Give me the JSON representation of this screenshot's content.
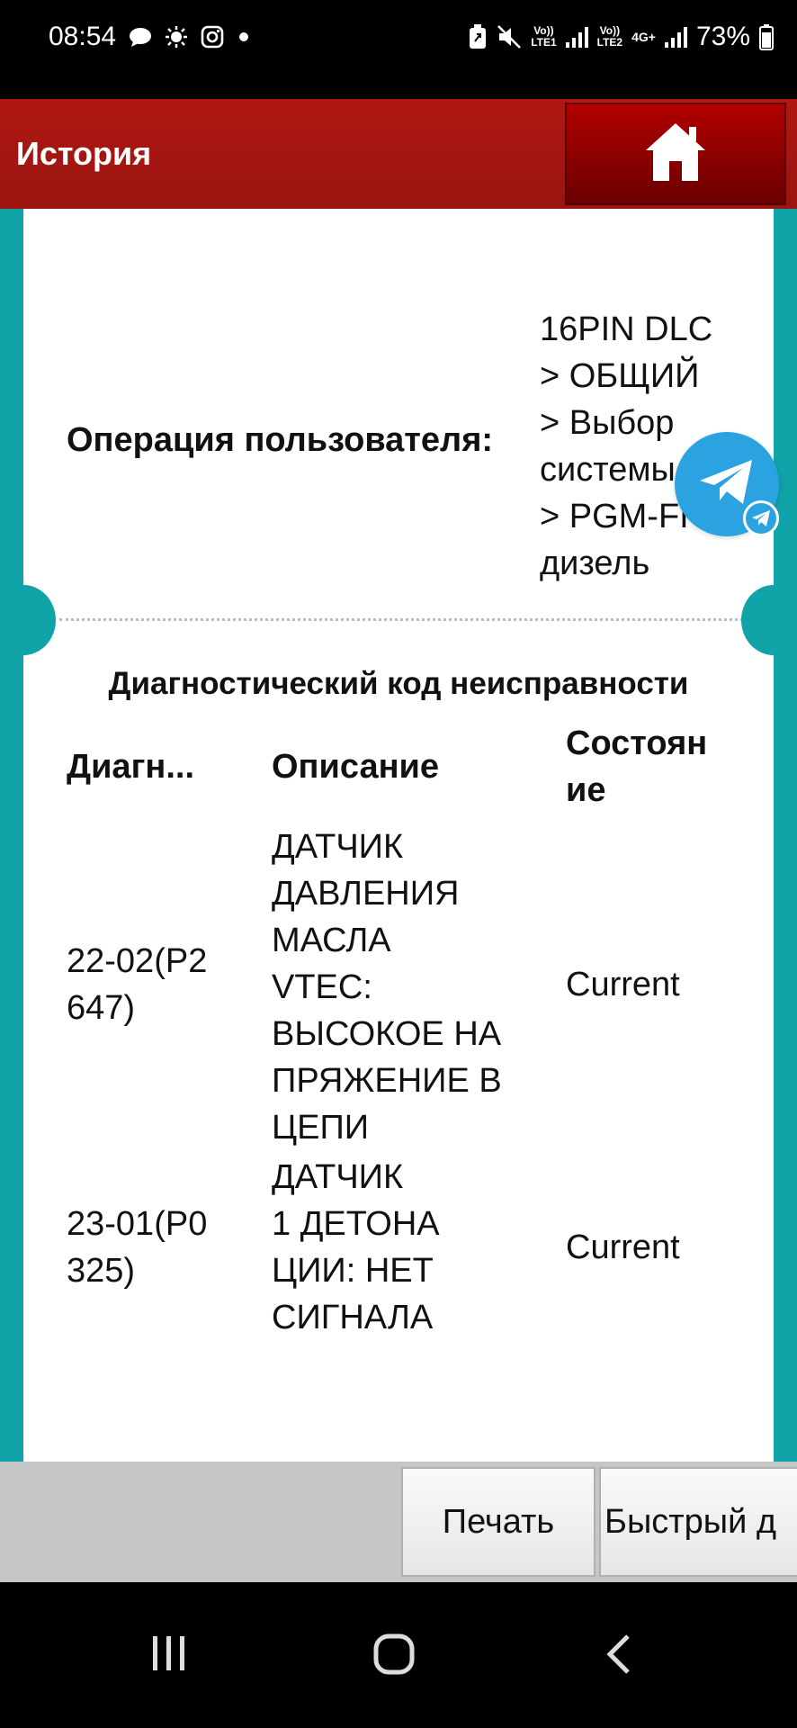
{
  "status_bar": {
    "time": "08:54",
    "sim1_label_top": "Vo))",
    "sim1_label_bottom": "LTE1",
    "sim2_label_top": "Vo))",
    "sim2_label_bottom": "LTE2",
    "network": "4G+",
    "battery": "73%",
    "icons": [
      "chat-icon",
      "brightness-icon",
      "instagram-icon",
      "dot-icon",
      "battery-saver-icon",
      "mute-icon",
      "signal-icon",
      "battery-icon"
    ]
  },
  "header": {
    "title": "История",
    "home_icon": "home-icon"
  },
  "operation": {
    "label": "Операция пользователя:",
    "value": "16PIN DLC\n> ОБЩИЙ\n> Выбор\nсистемы\n> PGM-FI\nдизель"
  },
  "dtc": {
    "title": "Диагностический код неисправности",
    "columns": [
      "Диагн...",
      "Описание",
      "Состоян\nие"
    ],
    "rows": [
      {
        "code": "22-02(P2\n647)",
        "description": "ДАТЧИК\nДАВЛЕНИЯ\nМАСЛА\nVTEC:\nВЫСОКОЕ НА\nПРЯЖЕНИЕ В\nЦЕПИ",
        "status": "Current"
      },
      {
        "code": "23-01(P0\n325)",
        "description": "ДАТЧИК\n1 ДЕТОНА\nЦИИ: НЕТ\nСИГНАЛА",
        "status": "Current"
      }
    ]
  },
  "toolbar": {
    "print_label": "Печать",
    "quick_label": "Быстрый д"
  },
  "colors": {
    "header_red": "#a3160f",
    "frame_teal": "#10a3a8",
    "telegram_blue": "#2aa3e0"
  }
}
